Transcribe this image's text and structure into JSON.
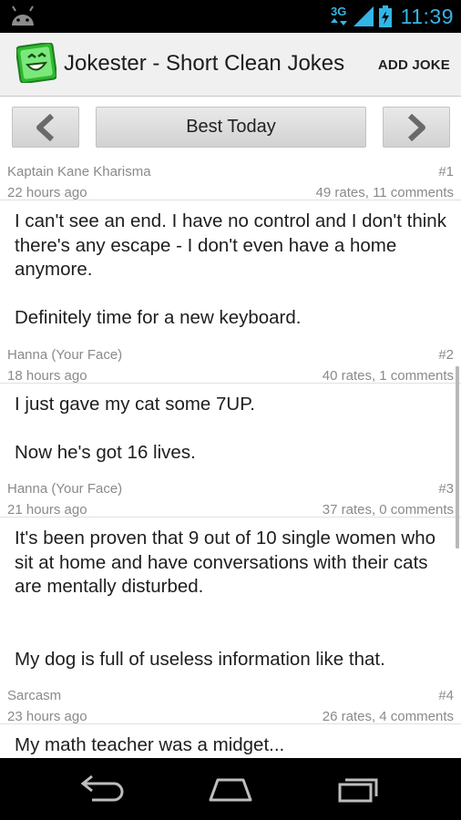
{
  "status_bar": {
    "time": "11:39",
    "network": "3G"
  },
  "action_bar": {
    "title": "Jokester - Short Clean Jokes",
    "add_joke": "ADD JOKE"
  },
  "nav": {
    "current": "Best Today"
  },
  "jokes": [
    {
      "author": "Kaptain Kane Kharisma",
      "rank": "#1",
      "time": "22 hours ago",
      "stats": "49 rates, 11 comments",
      "text": "I can't see an end. I have no control and I don't think there's any escape - I don't even have a home anymore.\n\nDefinitely time for a new keyboard."
    },
    {
      "author": "Hanna (Your Face)",
      "rank": "#2",
      "time": "18 hours ago",
      "stats": "40 rates, 1 comments",
      "text": "I just gave my cat some 7UP.\n\nNow he's got 16 lives."
    },
    {
      "author": "Hanna (Your Face)",
      "rank": "#3",
      "time": "21 hours ago",
      "stats": "37 rates, 0 comments",
      "text": "It's been proven that 9 out of 10 single women who sit at home and have conversations with their cats are mentally disturbed.\n\n\nMy dog is full of useless information like that."
    },
    {
      "author": "Sarcasm",
      "rank": "#4",
      "time": "23 hours ago",
      "stats": "26 rates, 4 comments",
      "text": "My math teacher was a midget..."
    }
  ],
  "colors": {
    "accent": "#33b5e5",
    "brand_green": "#2fb82f",
    "action_bar": "#f0f0f0"
  }
}
